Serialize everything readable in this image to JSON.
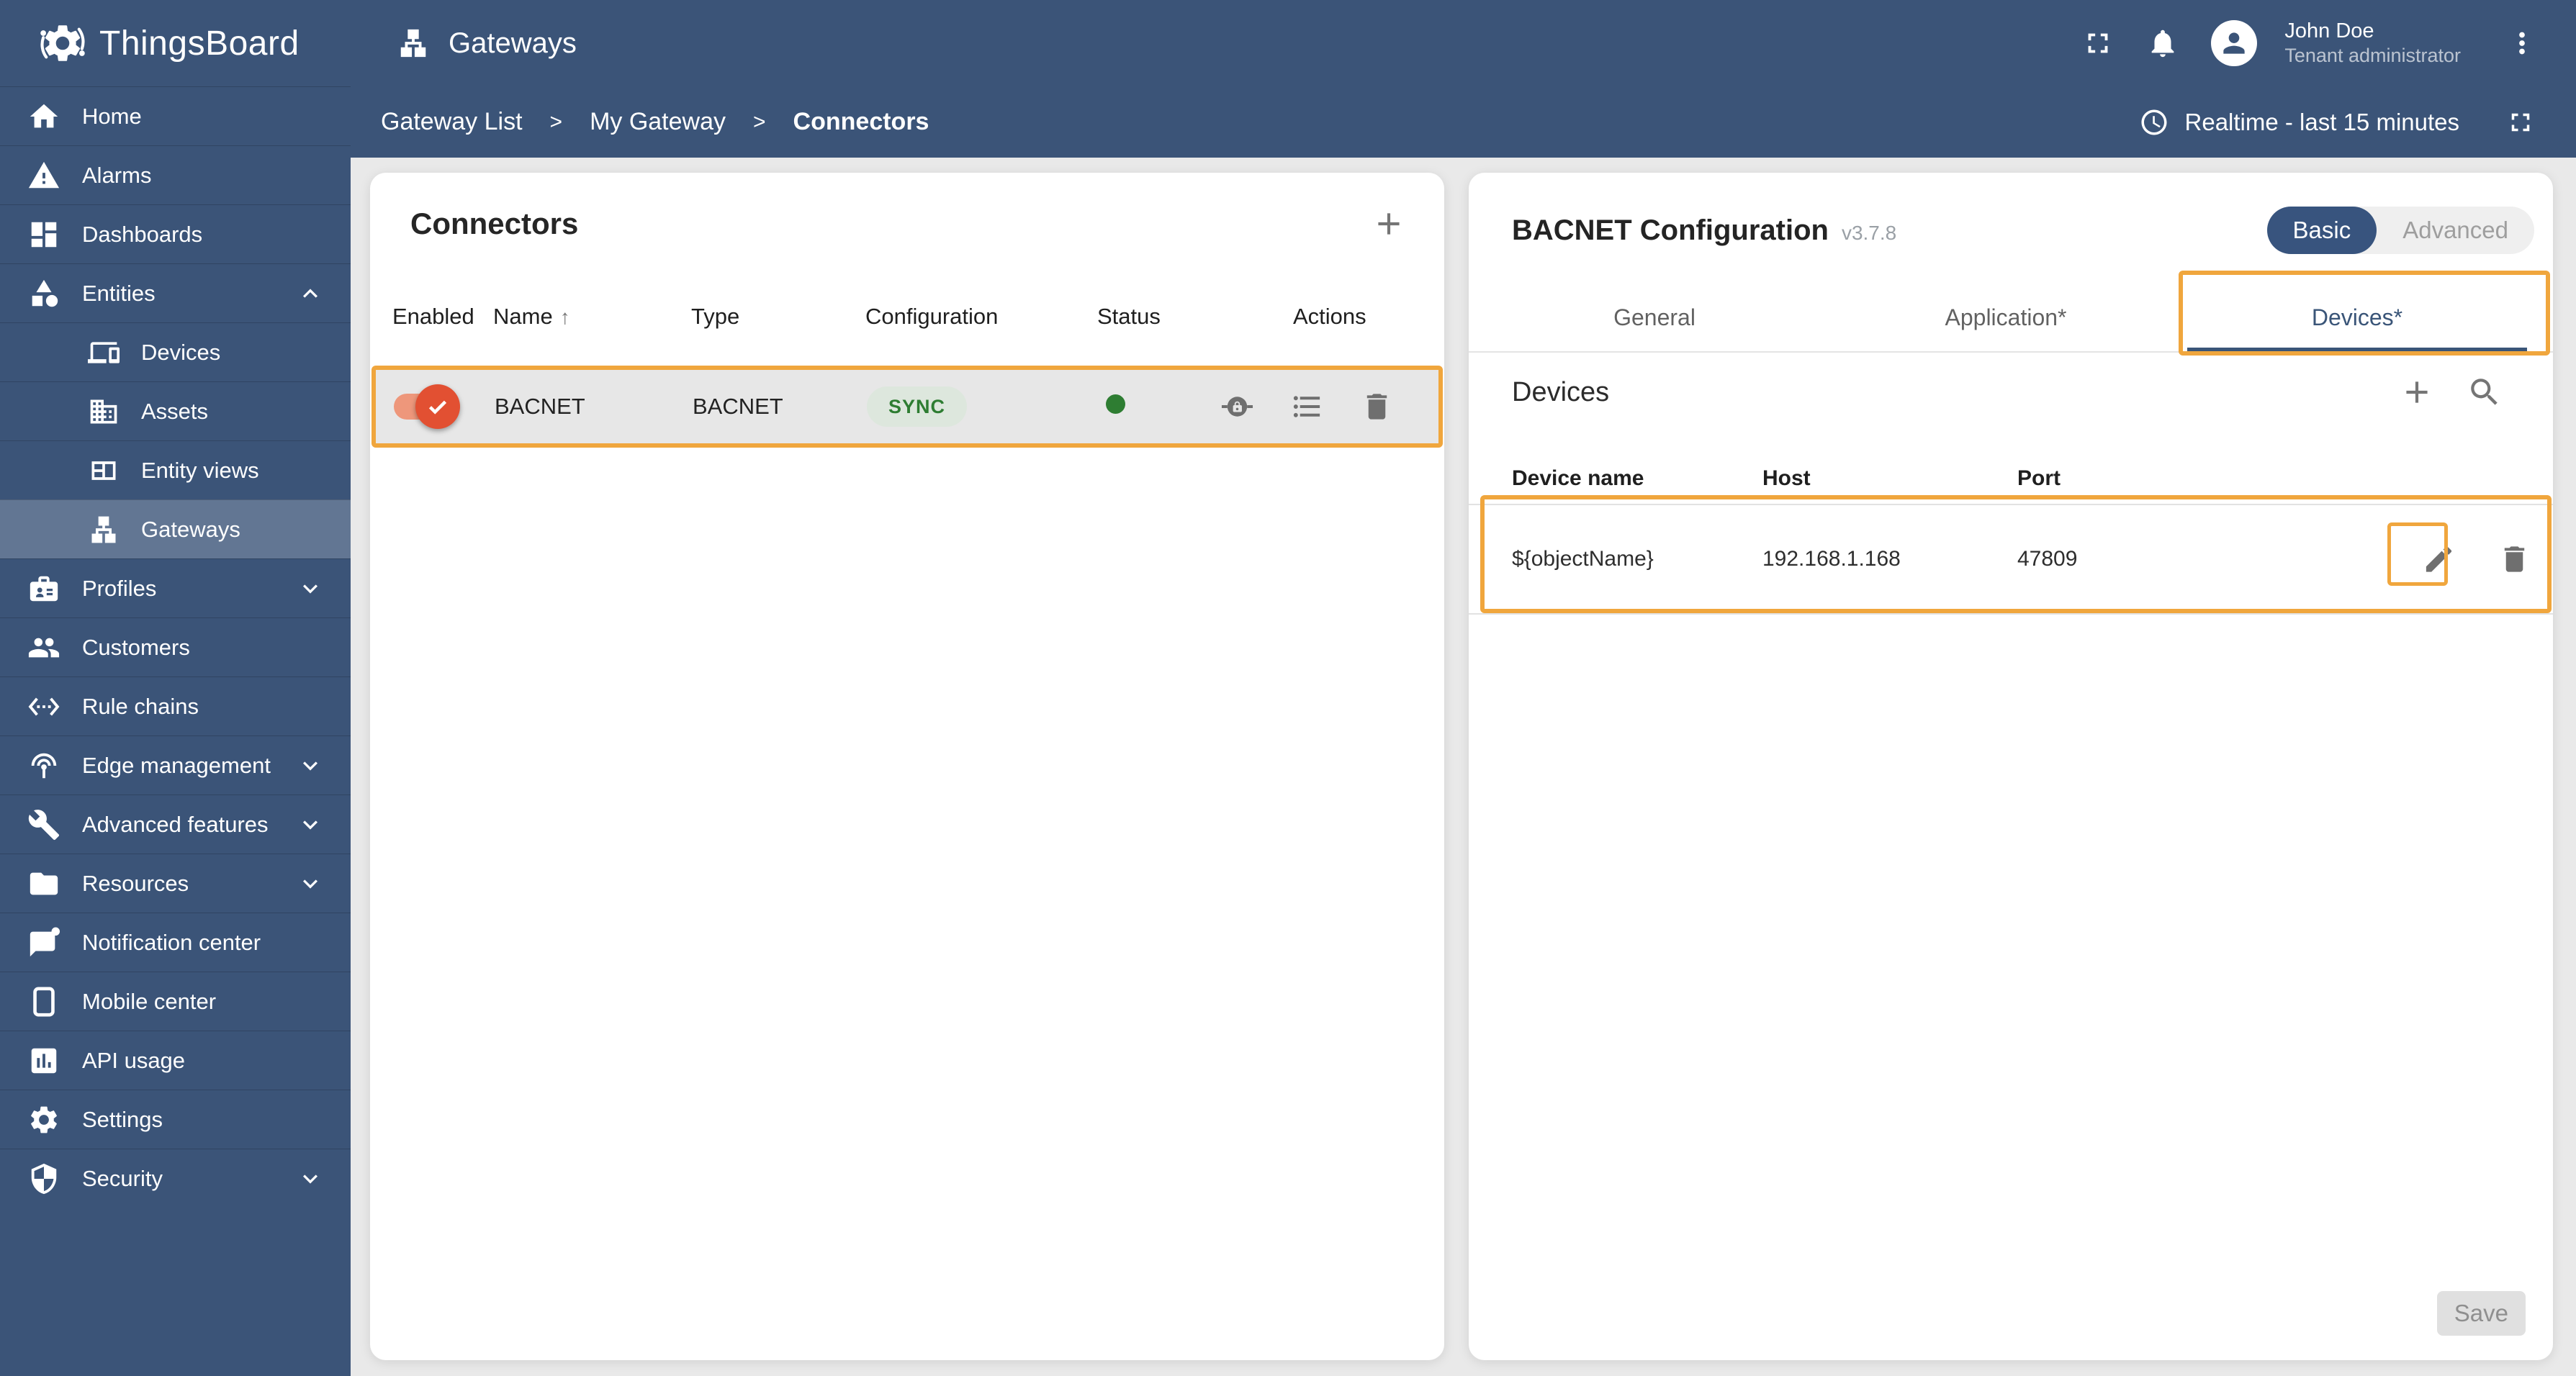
{
  "colors": {
    "primary_navy": "#3b5478",
    "annotation_orange": "#f0a63d",
    "toggle_on": "#e25032",
    "status_green": "#2e7d32",
    "card_bg": "#ffffff",
    "page_bg": "#e9e9e9"
  },
  "topbar": {
    "brand": "ThingsBoard",
    "section_title": "Gateways",
    "icons": [
      "fullscreen-icon",
      "notifications-bell-icon",
      "avatar",
      "more-vert-icon"
    ],
    "user": {
      "name": "John Doe",
      "role": "Tenant administrator"
    }
  },
  "breadcrumb": {
    "separator": ">",
    "items": [
      "Gateway List",
      "My Gateway",
      "Connectors"
    ],
    "current": "Connectors"
  },
  "timewindow": {
    "label": "Realtime - last 15 minutes",
    "icons": [
      "clock-icon",
      "fullscreen-icon"
    ]
  },
  "sidebar": {
    "items": [
      {
        "label": "Home",
        "icon": "home-icon"
      },
      {
        "label": "Alarms",
        "icon": "warning-icon"
      },
      {
        "label": "Dashboards",
        "icon": "dashboards-icon"
      },
      {
        "label": "Entities",
        "icon": "shapes-icon",
        "expandable": true,
        "expanded": true
      },
      {
        "label": "Devices",
        "icon": "devices-icon",
        "child": true
      },
      {
        "label": "Assets",
        "icon": "building-icon",
        "child": true
      },
      {
        "label": "Entity views",
        "icon": "view-quilt-icon",
        "child": true
      },
      {
        "label": "Gateways",
        "icon": "lan-icon",
        "child": true,
        "active": true
      },
      {
        "label": "Profiles",
        "icon": "badge-icon",
        "expandable": true
      },
      {
        "label": "Customers",
        "icon": "people-icon"
      },
      {
        "label": "Rule chains",
        "icon": "ethernet-icon"
      },
      {
        "label": "Edge management",
        "icon": "wifi-tethering-icon",
        "expandable": true
      },
      {
        "label": "Advanced features",
        "icon": "wrench-icon",
        "expandable": true
      },
      {
        "label": "Resources",
        "icon": "folder-icon",
        "expandable": true
      },
      {
        "label": "Notification center",
        "icon": "notification-icon"
      },
      {
        "label": "Mobile center",
        "icon": "mobile-icon"
      },
      {
        "label": "API usage",
        "icon": "bar-chart-icon"
      },
      {
        "label": "Settings",
        "icon": "gear-icon"
      },
      {
        "label": "Security",
        "icon": "shield-icon",
        "expandable": true
      }
    ]
  },
  "connectors": {
    "title": "Connectors",
    "add_icon": "plus-icon",
    "sort_icon": "↑",
    "columns": [
      "Enabled",
      "Name",
      "Type",
      "Configuration",
      "Status",
      "Actions"
    ],
    "rows": [
      {
        "enabled": true,
        "name": "BACNET",
        "type": "BACNET",
        "configuration": "SYNC",
        "status": "active",
        "actions": [
          "rpc-icon",
          "list-icon",
          "trash-icon"
        ]
      }
    ]
  },
  "config": {
    "title": "BACNET Configuration",
    "version": "v3.7.8",
    "mode_toggle": {
      "options": [
        "Basic",
        "Advanced"
      ],
      "selected": "Basic"
    },
    "tabs": [
      {
        "label": "General"
      },
      {
        "label": "Application*"
      },
      {
        "label": "Devices*",
        "active": true
      }
    ],
    "devices_section": {
      "title": "Devices",
      "icons": [
        "plus-icon",
        "search-icon"
      ],
      "columns": [
        "Device name",
        "Host",
        "Port"
      ],
      "rows": [
        {
          "device_name": "${objectName}",
          "host": "192.168.1.168",
          "port": "47809",
          "actions": [
            "pencil-icon",
            "trash-icon"
          ]
        }
      ]
    },
    "save_label": "Save"
  }
}
